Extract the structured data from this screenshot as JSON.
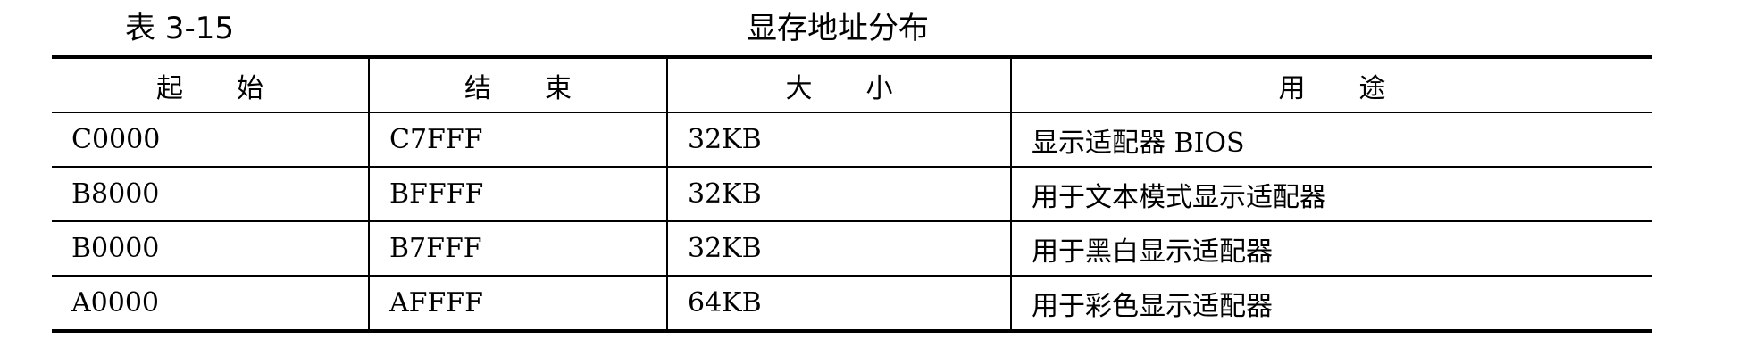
{
  "caption": {
    "number": "表 3-15",
    "title": "显存地址分布"
  },
  "table": {
    "headers": [
      "起　　始",
      "结　　束",
      "大　　小",
      "用　　途"
    ],
    "rows": [
      [
        "C0000",
        "C7FFF",
        "32KB",
        "显示适配器 BIOS"
      ],
      [
        "B8000",
        "BFFFF",
        "32KB",
        "用于文本模式显示适配器"
      ],
      [
        "B0000",
        "B7FFF",
        "32KB",
        "用于黑白显示适配器"
      ],
      [
        "A0000",
        "AFFFF",
        "64KB",
        "用于彩色显示适配器"
      ]
    ]
  }
}
